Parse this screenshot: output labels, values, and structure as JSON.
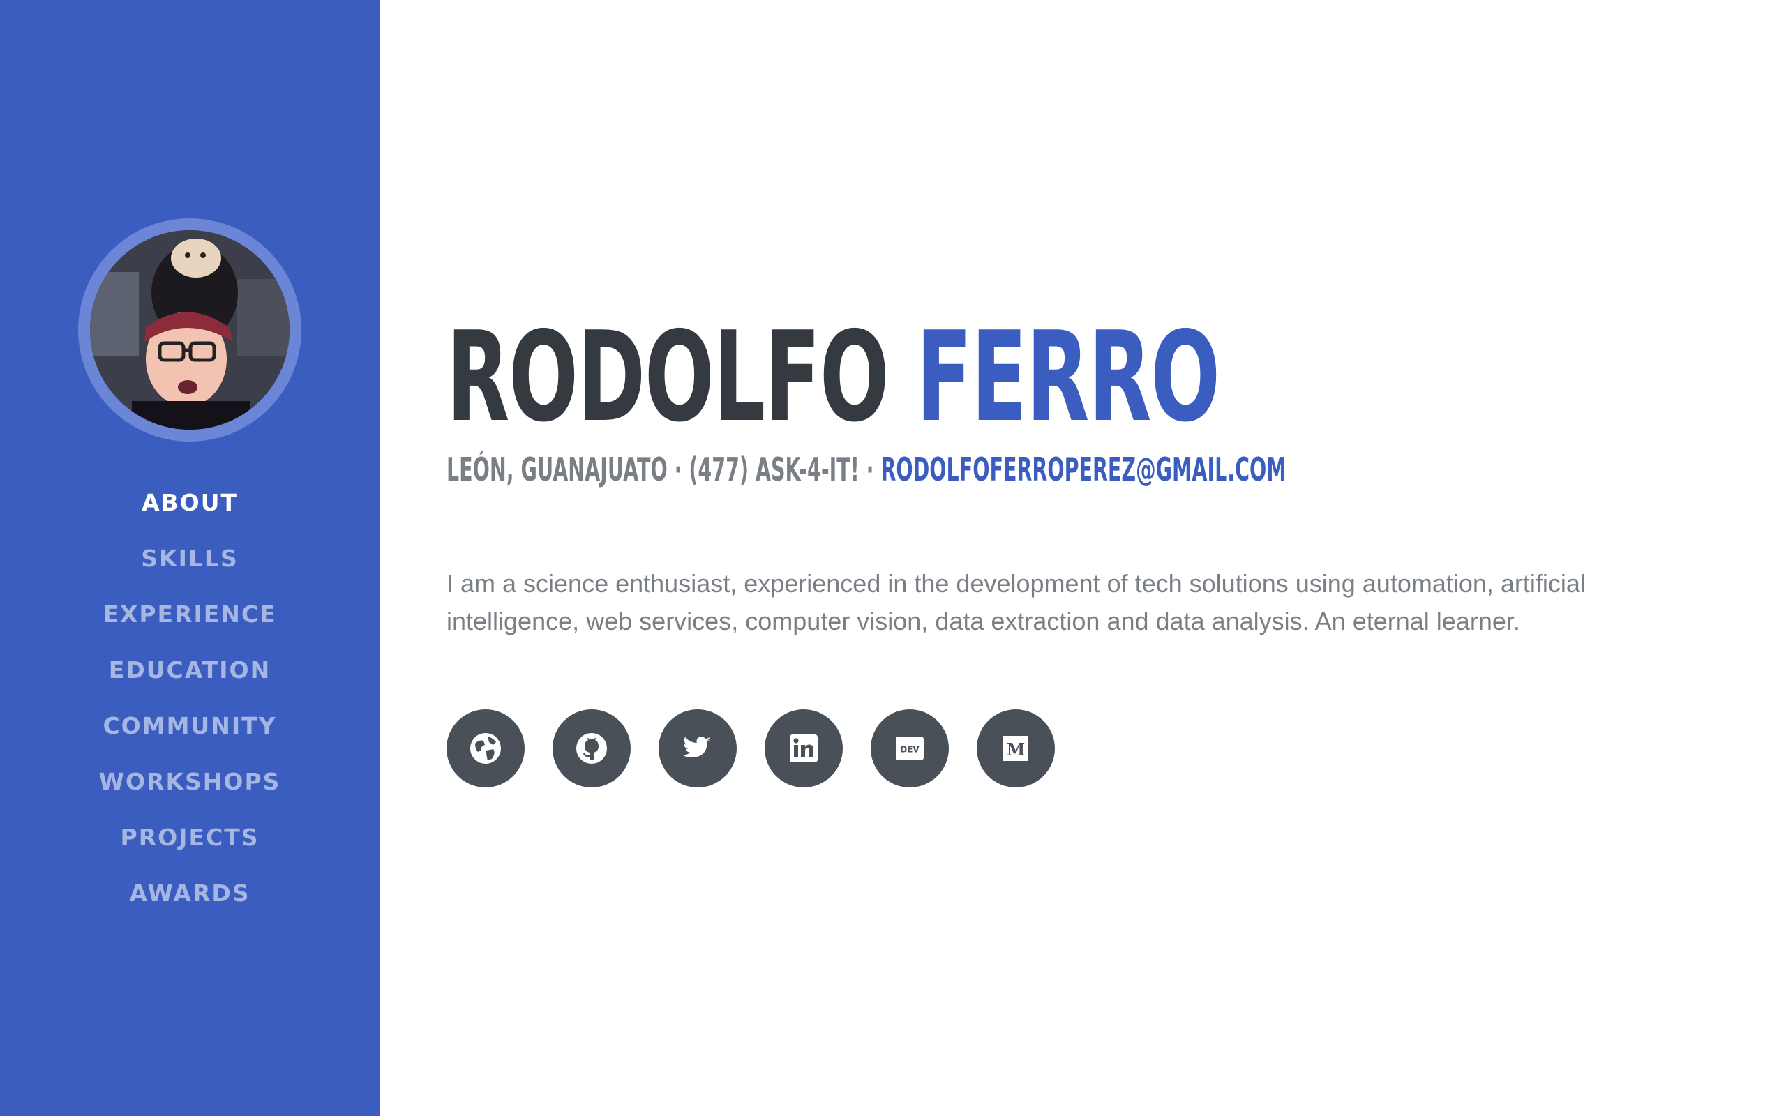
{
  "sidebar": {
    "nav": [
      {
        "label": "ABOUT",
        "active": true
      },
      {
        "label": "SKILLS"
      },
      {
        "label": "EXPERIENCE"
      },
      {
        "label": "EDUCATION"
      },
      {
        "label": "COMMUNITY"
      },
      {
        "label": "WORKSHOPS"
      },
      {
        "label": "PROJECTS"
      },
      {
        "label": "AWARDS"
      }
    ]
  },
  "header": {
    "first_name": "RODOLFO",
    "last_name": "FERRO",
    "location_phone": "LEÓN, GUANAJUATO · (477) ASK-4-IT! · ",
    "email": "RODOLFOFERROPEREZ@GMAIL.COM"
  },
  "about": {
    "bio": "I am a science enthusiast, experienced in the development of tech solutions using automation, artificial intelligence, web services, computer vision, data extraction and data analysis. An eternal learner."
  },
  "social": {
    "icons": [
      "globe-icon",
      "github-icon",
      "twitter-icon",
      "linkedin-icon",
      "dev-icon",
      "medium-icon"
    ],
    "dev_label": "DEV",
    "medium_label": "M"
  },
  "colors": {
    "primary": "#3b5dbf",
    "sidebar_bg": "#3b5dbf",
    "heading_dark": "#343a40",
    "muted_text": "#7a7f86",
    "social_bg": "#495057"
  }
}
